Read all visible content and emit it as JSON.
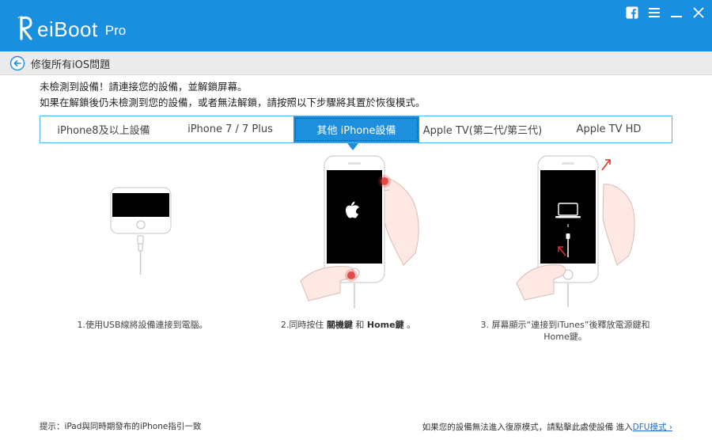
{
  "app": {
    "logo_name": "eiBoot",
    "logo_pro": "Pro"
  },
  "window_controls": [
    "facebook-icon",
    "menu-icon",
    "minimize-icon",
    "close-icon"
  ],
  "breadcrumb": {
    "title": "修復所有iOS問題"
  },
  "instructions": {
    "line1": "未檢測到設備！請連接您的設備，並解鎖屏幕。",
    "line2": "如果在解鎖後仍未檢測到您的設備，或者無法解鎖，請按照以下步驟將其置於恢復模式。"
  },
  "tabs": [
    {
      "label": "iPhone8及以上設備",
      "active": false
    },
    {
      "label": "iPhone 7 / 7 Plus",
      "active": false
    },
    {
      "label": "其他 iPhone設備",
      "active": true
    },
    {
      "label": "Apple TV(第二代/第三代)",
      "active": false
    },
    {
      "label": "Apple TV HD",
      "active": false
    }
  ],
  "steps": {
    "step1": "1.使用USB線將設備連接到電腦。",
    "step2_prefix": "2.同時按住 ",
    "step2_key1": "關機鍵",
    "step2_and": " 和 ",
    "step2_key2": "Home鍵",
    "step2_suffix": " 。",
    "step3_line1": "3. 屏幕顯示“連接到iTunes”後釋放電源鍵和",
    "step3_line2": "Home鍵。"
  },
  "footer": {
    "tip": "提示：iPad與同時期發布的iPhone指引一致",
    "dfu_prefix": "如果您的設備無法進入復原模式，請點擊此處使設備 進入",
    "dfu_link": "DFU模式 ›"
  },
  "colors": {
    "titlebar": "#1a8fe0",
    "tab_active": "#1e8fdc",
    "tab_border": "#58b2ec",
    "link": "#1e6fd0",
    "press_red": "#e0302a"
  }
}
